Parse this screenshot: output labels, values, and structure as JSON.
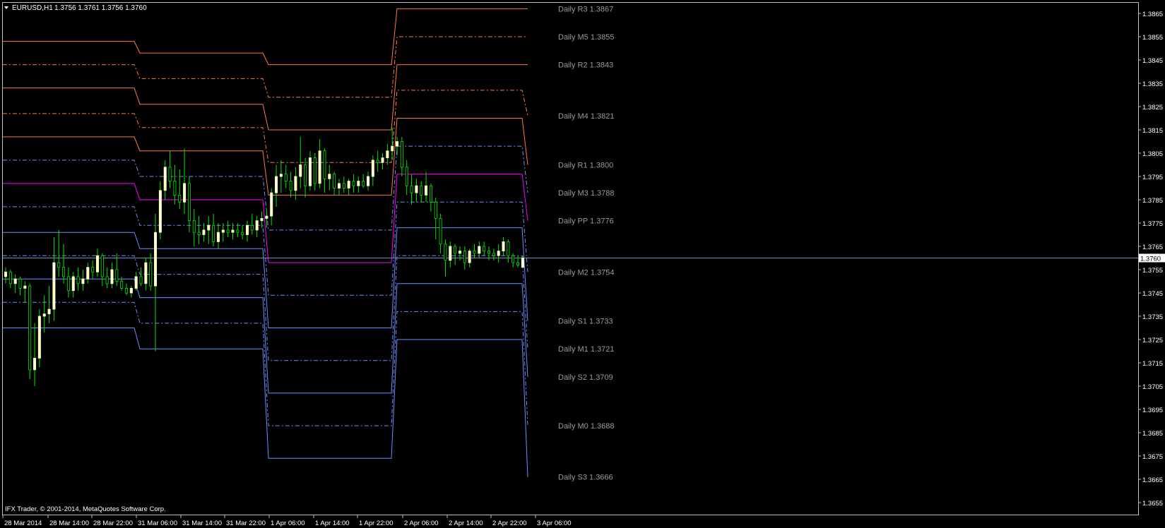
{
  "header": {
    "symbol": "EURUSD,H1",
    "quote": "1.3756 1.3761 1.3756 1.3760"
  },
  "footer": {
    "copyright": "IFX Trader, © 2001-2014, MetaQuotes Software Corp."
  },
  "current_price_label": "1.3760",
  "colors": {
    "background": "#000000",
    "frame": "#c0c0c0",
    "resistance": "#ff7a45",
    "pivot": "#ff00ff",
    "support": "#6b8fff",
    "bull_candle": "#ffffcc",
    "bear_candle": "#000000",
    "wick": "#00e600",
    "bid_line": "#6f8fbf",
    "label": "#9a9a9a"
  },
  "chart_data": {
    "type": "candlestick",
    "title": "EURUSD,H1",
    "ylim": [
      1.365,
      1.387
    ],
    "y_ticks": [
      "1.3865",
      "1.3855",
      "1.3845",
      "1.3835",
      "1.3825",
      "1.3815",
      "1.3805",
      "1.3795",
      "1.3785",
      "1.3775",
      "1.3765",
      "1.3755",
      "1.3745",
      "1.3735",
      "1.3725",
      "1.3715",
      "1.3705",
      "1.3695",
      "1.3685",
      "1.3675",
      "1.3665",
      "1.3655"
    ],
    "x_ticks": [
      "28 Mar 2014",
      "28 Mar 14:00",
      "28 Mar 22:00",
      "31 Mar 06:00",
      "31 Mar 14:00",
      "31 Mar 22:00",
      "1 Apr 06:00",
      "1 Apr 14:00",
      "1 Apr 22:00",
      "2 Apr 06:00",
      "2 Apr 14:00",
      "2 Apr 22:00",
      "3 Apr 06:00"
    ],
    "current_price": 1.376,
    "pivot_sessions": [
      {
        "R3": 1.3853,
        "M5": 1.3843,
        "R2": 1.3833,
        "M4": 1.3822,
        "R1": 1.3812,
        "M3": 1.3802,
        "PP": 1.3792,
        "M2": 1.3782,
        "S1": 1.3771,
        "M1": 1.3761,
        "S2": 1.3751,
        "M0": 1.3741,
        "S3": 1.373
      },
      {
        "R3": 1.3848,
        "M5": 1.3837,
        "R2": 1.3826,
        "M4": 1.3816,
        "R1": 1.3806,
        "M3": 1.3795,
        "PP": 1.3785,
        "M2": 1.3774,
        "S1": 1.3764,
        "M1": 1.3753,
        "S2": 1.3743,
        "M0": 1.3732,
        "S3": 1.3721
      },
      {
        "R3": 1.3843,
        "M5": 1.3829,
        "R2": 1.3815,
        "M4": 1.3801,
        "R1": 1.3787,
        "M3": 1.3772,
        "PP": 1.3758,
        "M2": 1.3744,
        "S1": 1.373,
        "M1": 1.3716,
        "S2": 1.3702,
        "M0": 1.3688,
        "S3": 1.3674
      },
      {
        "R3": 1.3867,
        "M5": 1.3855,
        "R2": 1.3843,
        "M4": 1.3832,
        "R1": 1.382,
        "M3": 1.3808,
        "PP": 1.3796,
        "M2": 1.3784,
        "S1": 1.3773,
        "M1": 1.3761,
        "S2": 1.3749,
        "M0": 1.3737,
        "S3": 1.3725
      },
      {
        "R3": 1.3867,
        "M5": 1.3855,
        "R2": 1.3843,
        "M4": 1.3821,
        "R1": 1.38,
        "M3": 1.3788,
        "PP": 1.3776,
        "M2": 1.3754,
        "S1": 1.3733,
        "M1": 1.3721,
        "S2": 1.3709,
        "M0": 1.3688,
        "S3": 1.3666
      }
    ],
    "pivot_labels": [
      {
        "key": "R3",
        "text": "Daily R3 1.3867"
      },
      {
        "key": "M5",
        "text": "Daily M5 1.3855"
      },
      {
        "key": "R2",
        "text": "Daily R2 1.3843"
      },
      {
        "key": "M4",
        "text": "Daily M4 1.3821"
      },
      {
        "key": "R1",
        "text": "Daily R1 1.3800"
      },
      {
        "key": "M3",
        "text": "Daily M3 1.3788"
      },
      {
        "key": "PP",
        "text": "Daily PP 1.3776"
      },
      {
        "key": "M2",
        "text": "Daily M2 1.3754"
      },
      {
        "key": "S1",
        "text": "Daily S1 1.3733"
      },
      {
        "key": "M1",
        "text": "Daily M1 1.3721"
      },
      {
        "key": "S2",
        "text": "Daily S2 1.3709"
      },
      {
        "key": "M0",
        "text": "Daily M0 1.3688"
      },
      {
        "key": "S3",
        "text": "Daily S3 1.3666"
      }
    ],
    "candles": [
      {
        "o": 1.3752,
        "h": 1.3756,
        "l": 1.3749,
        "c": 1.3754
      },
      {
        "o": 1.3754,
        "h": 1.3755,
        "l": 1.3747,
        "c": 1.3749
      },
      {
        "o": 1.3749,
        "h": 1.3753,
        "l": 1.3745,
        "c": 1.3751
      },
      {
        "o": 1.3751,
        "h": 1.3752,
        "l": 1.3744,
        "c": 1.3747
      },
      {
        "o": 1.3747,
        "h": 1.375,
        "l": 1.3741,
        "c": 1.3748
      },
      {
        "o": 1.3748,
        "h": 1.3749,
        "l": 1.3708,
        "c": 1.3712
      },
      {
        "o": 1.3712,
        "h": 1.3732,
        "l": 1.3705,
        "c": 1.3717
      },
      {
        "o": 1.3717,
        "h": 1.3738,
        "l": 1.3713,
        "c": 1.3735
      },
      {
        "o": 1.3735,
        "h": 1.3744,
        "l": 1.3728,
        "c": 1.3736
      },
      {
        "o": 1.3736,
        "h": 1.3748,
        "l": 1.3732,
        "c": 1.3738
      },
      {
        "o": 1.3738,
        "h": 1.3769,
        "l": 1.3733,
        "c": 1.3758
      },
      {
        "o": 1.3758,
        "h": 1.3772,
        "l": 1.3752,
        "c": 1.3756
      },
      {
        "o": 1.3756,
        "h": 1.3766,
        "l": 1.3749,
        "c": 1.3752
      },
      {
        "o": 1.3752,
        "h": 1.3756,
        "l": 1.3743,
        "c": 1.3746
      },
      {
        "o": 1.3746,
        "h": 1.3754,
        "l": 1.3743,
        "c": 1.3752
      },
      {
        "o": 1.3752,
        "h": 1.3756,
        "l": 1.3746,
        "c": 1.3749
      },
      {
        "o": 1.3749,
        "h": 1.3755,
        "l": 1.3746,
        "c": 1.3751
      },
      {
        "o": 1.3751,
        "h": 1.3758,
        "l": 1.3749,
        "c": 1.3756
      },
      {
        "o": 1.3756,
        "h": 1.3759,
        "l": 1.3751,
        "c": 1.3754
      },
      {
        "o": 1.3754,
        "h": 1.3764,
        "l": 1.3752,
        "c": 1.3761
      },
      {
        "o": 1.3761,
        "h": 1.3762,
        "l": 1.3748,
        "c": 1.3752
      },
      {
        "o": 1.3752,
        "h": 1.3756,
        "l": 1.3747,
        "c": 1.3749
      },
      {
        "o": 1.3749,
        "h": 1.3758,
        "l": 1.3747,
        "c": 1.3755
      },
      {
        "o": 1.3755,
        "h": 1.3762,
        "l": 1.3748,
        "c": 1.375
      },
      {
        "o": 1.375,
        "h": 1.3752,
        "l": 1.3746,
        "c": 1.3747
      },
      {
        "o": 1.3747,
        "h": 1.3749,
        "l": 1.3744,
        "c": 1.3745
      },
      {
        "o": 1.3745,
        "h": 1.3748,
        "l": 1.3743,
        "c": 1.3747
      },
      {
        "o": 1.3747,
        "h": 1.3754,
        "l": 1.3746,
        "c": 1.3752
      },
      {
        "o": 1.3752,
        "h": 1.3756,
        "l": 1.3748,
        "c": 1.3749
      },
      {
        "o": 1.3749,
        "h": 1.376,
        "l": 1.3746,
        "c": 1.3758
      },
      {
        "o": 1.3758,
        "h": 1.3762,
        "l": 1.3746,
        "c": 1.3748
      },
      {
        "o": 1.3748,
        "h": 1.3779,
        "l": 1.372,
        "c": 1.3771
      },
      {
        "o": 1.3771,
        "h": 1.3793,
        "l": 1.3768,
        "c": 1.3789
      },
      {
        "o": 1.3789,
        "h": 1.3802,
        "l": 1.3785,
        "c": 1.3799
      },
      {
        "o": 1.3799,
        "h": 1.3806,
        "l": 1.379,
        "c": 1.3793
      },
      {
        "o": 1.3793,
        "h": 1.38,
        "l": 1.3783,
        "c": 1.3787
      },
      {
        "o": 1.3787,
        "h": 1.3798,
        "l": 1.3781,
        "c": 1.3784
      },
      {
        "o": 1.3784,
        "h": 1.3807,
        "l": 1.3779,
        "c": 1.3792
      },
      {
        "o": 1.3792,
        "h": 1.3795,
        "l": 1.3771,
        "c": 1.3776
      },
      {
        "o": 1.3776,
        "h": 1.3781,
        "l": 1.3765,
        "c": 1.3771
      },
      {
        "o": 1.3771,
        "h": 1.3778,
        "l": 1.3766,
        "c": 1.377
      },
      {
        "o": 1.377,
        "h": 1.3775,
        "l": 1.3767,
        "c": 1.3772
      },
      {
        "o": 1.3772,
        "h": 1.3778,
        "l": 1.3766,
        "c": 1.3774
      },
      {
        "o": 1.3774,
        "h": 1.3779,
        "l": 1.3765,
        "c": 1.3767
      },
      {
        "o": 1.3767,
        "h": 1.3775,
        "l": 1.3764,
        "c": 1.3771
      },
      {
        "o": 1.3771,
        "h": 1.3775,
        "l": 1.3767,
        "c": 1.3772
      },
      {
        "o": 1.3772,
        "h": 1.3776,
        "l": 1.3769,
        "c": 1.3771
      },
      {
        "o": 1.3771,
        "h": 1.3775,
        "l": 1.3768,
        "c": 1.3772
      },
      {
        "o": 1.3772,
        "h": 1.3775,
        "l": 1.3769,
        "c": 1.3771
      },
      {
        "o": 1.3771,
        "h": 1.3774,
        "l": 1.3768,
        "c": 1.377
      },
      {
        "o": 1.377,
        "h": 1.3776,
        "l": 1.3767,
        "c": 1.3774
      },
      {
        "o": 1.3774,
        "h": 1.3779,
        "l": 1.377,
        "c": 1.3772
      },
      {
        "o": 1.3772,
        "h": 1.3778,
        "l": 1.3769,
        "c": 1.3776
      },
      {
        "o": 1.3776,
        "h": 1.378,
        "l": 1.3773,
        "c": 1.3777
      },
      {
        "o": 1.3777,
        "h": 1.3781,
        "l": 1.3773,
        "c": 1.3778
      },
      {
        "o": 1.3778,
        "h": 1.379,
        "l": 1.3774,
        "c": 1.3788
      },
      {
        "o": 1.3788,
        "h": 1.38,
        "l": 1.3782,
        "c": 1.3795
      },
      {
        "o": 1.3795,
        "h": 1.3802,
        "l": 1.3788,
        "c": 1.3796
      },
      {
        "o": 1.3796,
        "h": 1.38,
        "l": 1.379,
        "c": 1.3793
      },
      {
        "o": 1.3793,
        "h": 1.3797,
        "l": 1.3786,
        "c": 1.3789
      },
      {
        "o": 1.3789,
        "h": 1.3799,
        "l": 1.3785,
        "c": 1.3795
      },
      {
        "o": 1.3795,
        "h": 1.3812,
        "l": 1.379,
        "c": 1.38
      },
      {
        "o": 1.38,
        "h": 1.3803,
        "l": 1.3786,
        "c": 1.3791
      },
      {
        "o": 1.3791,
        "h": 1.3806,
        "l": 1.3789,
        "c": 1.3803
      },
      {
        "o": 1.3803,
        "h": 1.3805,
        "l": 1.3789,
        "c": 1.3792
      },
      {
        "o": 1.3792,
        "h": 1.3811,
        "l": 1.379,
        "c": 1.3806
      },
      {
        "o": 1.3806,
        "h": 1.3807,
        "l": 1.3788,
        "c": 1.3794
      },
      {
        "o": 1.3794,
        "h": 1.38,
        "l": 1.3789,
        "c": 1.3796
      },
      {
        "o": 1.3796,
        "h": 1.3797,
        "l": 1.3787,
        "c": 1.379
      },
      {
        "o": 1.379,
        "h": 1.3794,
        "l": 1.3787,
        "c": 1.3792
      },
      {
        "o": 1.3792,
        "h": 1.3795,
        "l": 1.3788,
        "c": 1.379
      },
      {
        "o": 1.379,
        "h": 1.3794,
        "l": 1.3787,
        "c": 1.3793
      },
      {
        "o": 1.3793,
        "h": 1.3796,
        "l": 1.3788,
        "c": 1.3791
      },
      {
        "o": 1.3791,
        "h": 1.3795,
        "l": 1.3788,
        "c": 1.3793
      },
      {
        "o": 1.3793,
        "h": 1.3796,
        "l": 1.379,
        "c": 1.3791
      },
      {
        "o": 1.3791,
        "h": 1.3797,
        "l": 1.3789,
        "c": 1.3795
      },
      {
        "o": 1.3795,
        "h": 1.3804,
        "l": 1.3791,
        "c": 1.3802
      },
      {
        "o": 1.3802,
        "h": 1.3806,
        "l": 1.3797,
        "c": 1.3801
      },
      {
        "o": 1.3801,
        "h": 1.3805,
        "l": 1.3798,
        "c": 1.3803
      },
      {
        "o": 1.3803,
        "h": 1.3809,
        "l": 1.38,
        "c": 1.3806
      },
      {
        "o": 1.3806,
        "h": 1.3816,
        "l": 1.3802,
        "c": 1.3808
      },
      {
        "o": 1.3808,
        "h": 1.3812,
        "l": 1.3804,
        "c": 1.381
      },
      {
        "o": 1.381,
        "h": 1.3812,
        "l": 1.3795,
        "c": 1.3799
      },
      {
        "o": 1.3799,
        "h": 1.3802,
        "l": 1.3787,
        "c": 1.3791
      },
      {
        "o": 1.3791,
        "h": 1.3796,
        "l": 1.3783,
        "c": 1.3788
      },
      {
        "o": 1.3788,
        "h": 1.3794,
        "l": 1.3784,
        "c": 1.3791
      },
      {
        "o": 1.3791,
        "h": 1.3793,
        "l": 1.3784,
        "c": 1.3787
      },
      {
        "o": 1.3787,
        "h": 1.3797,
        "l": 1.3784,
        "c": 1.3791
      },
      {
        "o": 1.3791,
        "h": 1.3792,
        "l": 1.378,
        "c": 1.3784
      },
      {
        "o": 1.3784,
        "h": 1.3786,
        "l": 1.3768,
        "c": 1.3777
      },
      {
        "o": 1.3777,
        "h": 1.3779,
        "l": 1.3762,
        "c": 1.3766
      },
      {
        "o": 1.3766,
        "h": 1.3768,
        "l": 1.3752,
        "c": 1.3759
      },
      {
        "o": 1.3759,
        "h": 1.3767,
        "l": 1.3756,
        "c": 1.3765
      },
      {
        "o": 1.3765,
        "h": 1.3766,
        "l": 1.3757,
        "c": 1.3762
      },
      {
        "o": 1.3762,
        "h": 1.3765,
        "l": 1.3759,
        "c": 1.3763
      },
      {
        "o": 1.3763,
        "h": 1.3765,
        "l": 1.3755,
        "c": 1.3758
      },
      {
        "o": 1.3758,
        "h": 1.3764,
        "l": 1.3756,
        "c": 1.3763
      },
      {
        "o": 1.3763,
        "h": 1.3766,
        "l": 1.376,
        "c": 1.3762
      },
      {
        "o": 1.3762,
        "h": 1.3767,
        "l": 1.376,
        "c": 1.3765
      },
      {
        "o": 1.3765,
        "h": 1.3767,
        "l": 1.3761,
        "c": 1.3763
      },
      {
        "o": 1.3763,
        "h": 1.3765,
        "l": 1.3759,
        "c": 1.3762
      },
      {
        "o": 1.3762,
        "h": 1.3764,
        "l": 1.3759,
        "c": 1.3761
      },
      {
        "o": 1.3761,
        "h": 1.3766,
        "l": 1.3758,
        "c": 1.3763
      },
      {
        "o": 1.3763,
        "h": 1.3769,
        "l": 1.3761,
        "c": 1.3767
      },
      {
        "o": 1.3767,
        "h": 1.3768,
        "l": 1.3758,
        "c": 1.3761
      },
      {
        "o": 1.3761,
        "h": 1.3762,
        "l": 1.3756,
        "c": 1.3758
      },
      {
        "o": 1.3758,
        "h": 1.3761,
        "l": 1.3756,
        "c": 1.3757
      },
      {
        "o": 1.3756,
        "h": 1.3761,
        "l": 1.3756,
        "c": 1.376
      }
    ]
  }
}
